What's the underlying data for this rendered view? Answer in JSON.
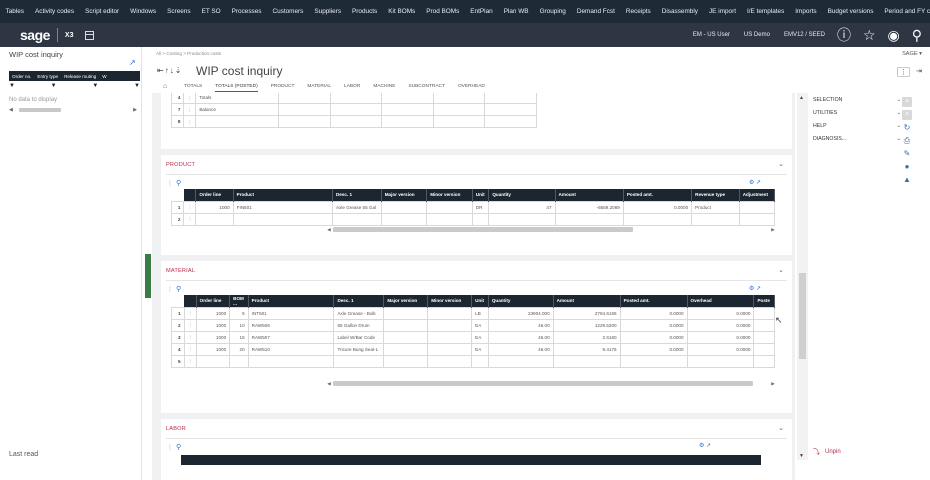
{
  "top_menu": [
    "Tables",
    "Activity codes",
    "Script editor",
    "Windows",
    "Screens",
    "ET SO",
    "Processes",
    "Customers",
    "Suppliers",
    "Products",
    "Kit BOMs",
    "Prod BOMs",
    "EntPlan",
    "Plan WB",
    "Grouping",
    "Demand Fcst",
    "Receipts",
    "Disassembly",
    "JE import",
    "I/E templates",
    "Imports",
    "Budget versions",
    "Period and FY closing"
  ],
  "brand": {
    "logo": "sage",
    "product": "X3",
    "user": "EM - US User",
    "folder": "US Demo",
    "server": "EMV12 / SEED"
  },
  "left_panel": {
    "title": "WIP cost inquiry",
    "columns": [
      "Order no.",
      "Entry type",
      "Release routing",
      "W"
    ],
    "empty_text": "No data to display",
    "footer": "Last read"
  },
  "breadcrumb": "All  >  Costing  >  Production costs",
  "page_title": "WIP cost inquiry",
  "tabs": [
    "TOTALS",
    "TOTALS (POSTED)",
    "PRODUCT",
    "MATERIAL",
    "LABOR",
    "MACHINE",
    "SUBCONTRACT",
    "OVERHEAD"
  ],
  "top_block": {
    "rows": [
      {
        "n": "4",
        "label": "Totals"
      },
      {
        "n": "7",
        "label": "Balance"
      },
      {
        "n": "8",
        "label": ""
      }
    ]
  },
  "product": {
    "title": "PRODUCT",
    "columns": [
      "Order line",
      "Product",
      "Desc. 1",
      "Major version",
      "Minor version",
      "Unit",
      "Quantity",
      "Amount",
      "Posted amt.",
      "Revenue type",
      "Adjustment"
    ],
    "rows": [
      {
        "n": "1",
        "order_line": "1000",
        "product": "FIN501",
        "desc": "Axle Grease 55 Gal",
        "major": "",
        "minor": "",
        "unit": "DR",
        "qty": "47",
        "amount": "-6659.2069",
        "posted": "0.0000",
        "rev_type": "Product",
        "adj": ""
      },
      {
        "n": "2",
        "order_line": "",
        "product": "",
        "desc": "",
        "major": "",
        "minor": "",
        "unit": "",
        "qty": "",
        "amount": "",
        "posted": "",
        "rev_type": "",
        "adj": ""
      }
    ]
  },
  "material": {
    "title": "MATERIAL",
    "columns": [
      "Order line",
      "BOM ...",
      "Product",
      "Desc. 1",
      "Major version",
      "Minor version",
      "Unit",
      "Quantity",
      "Amount",
      "Posted amt.",
      "Overhead",
      "Poste"
    ],
    "rows": [
      {
        "n": "1",
        "order_line": "1000",
        "bom": "5",
        "product": "INT501",
        "desc": "Axle Grease - Bulk",
        "unit": "LB",
        "qty": "23904.000",
        "amount": "2794.6166",
        "posted": "0.0000",
        "overhead": "0.0000"
      },
      {
        "n": "2",
        "order_line": "1000",
        "bom": "10",
        "product": "RAW506",
        "desc": "55 Gallon Drum",
        "unit": "EA",
        "qty": "46.00",
        "amount": "1229.5300",
        "posted": "0.0000",
        "overhead": "0.0000"
      },
      {
        "n": "3",
        "order_line": "1000",
        "bom": "15",
        "product": "RAW507",
        "desc": "Label W/Bar Code",
        "unit": "EA",
        "qty": "46.00",
        "amount": "2.6160",
        "posted": "0.0000",
        "overhead": "0.0000"
      },
      {
        "n": "4",
        "order_line": "1000",
        "bom": "20",
        "product": "RAW510",
        "desc": "Tricure Bung Seal-L",
        "unit": "EA",
        "qty": "46.00",
        "amount": "9.4176",
        "posted": "0.0000",
        "overhead": "0.0000"
      },
      {
        "n": "5",
        "order_line": "",
        "bom": "",
        "product": "",
        "desc": "",
        "unit": "",
        "qty": "",
        "amount": "",
        "posted": "",
        "overhead": ""
      }
    ]
  },
  "labor": {
    "title": "LABOR"
  },
  "right_panel": {
    "folder_label": "SAGE",
    "items": [
      "SELECTION",
      "UTILITIES",
      "HELP",
      "DIAGNOSIS..."
    ],
    "unpin": "Unpin"
  }
}
